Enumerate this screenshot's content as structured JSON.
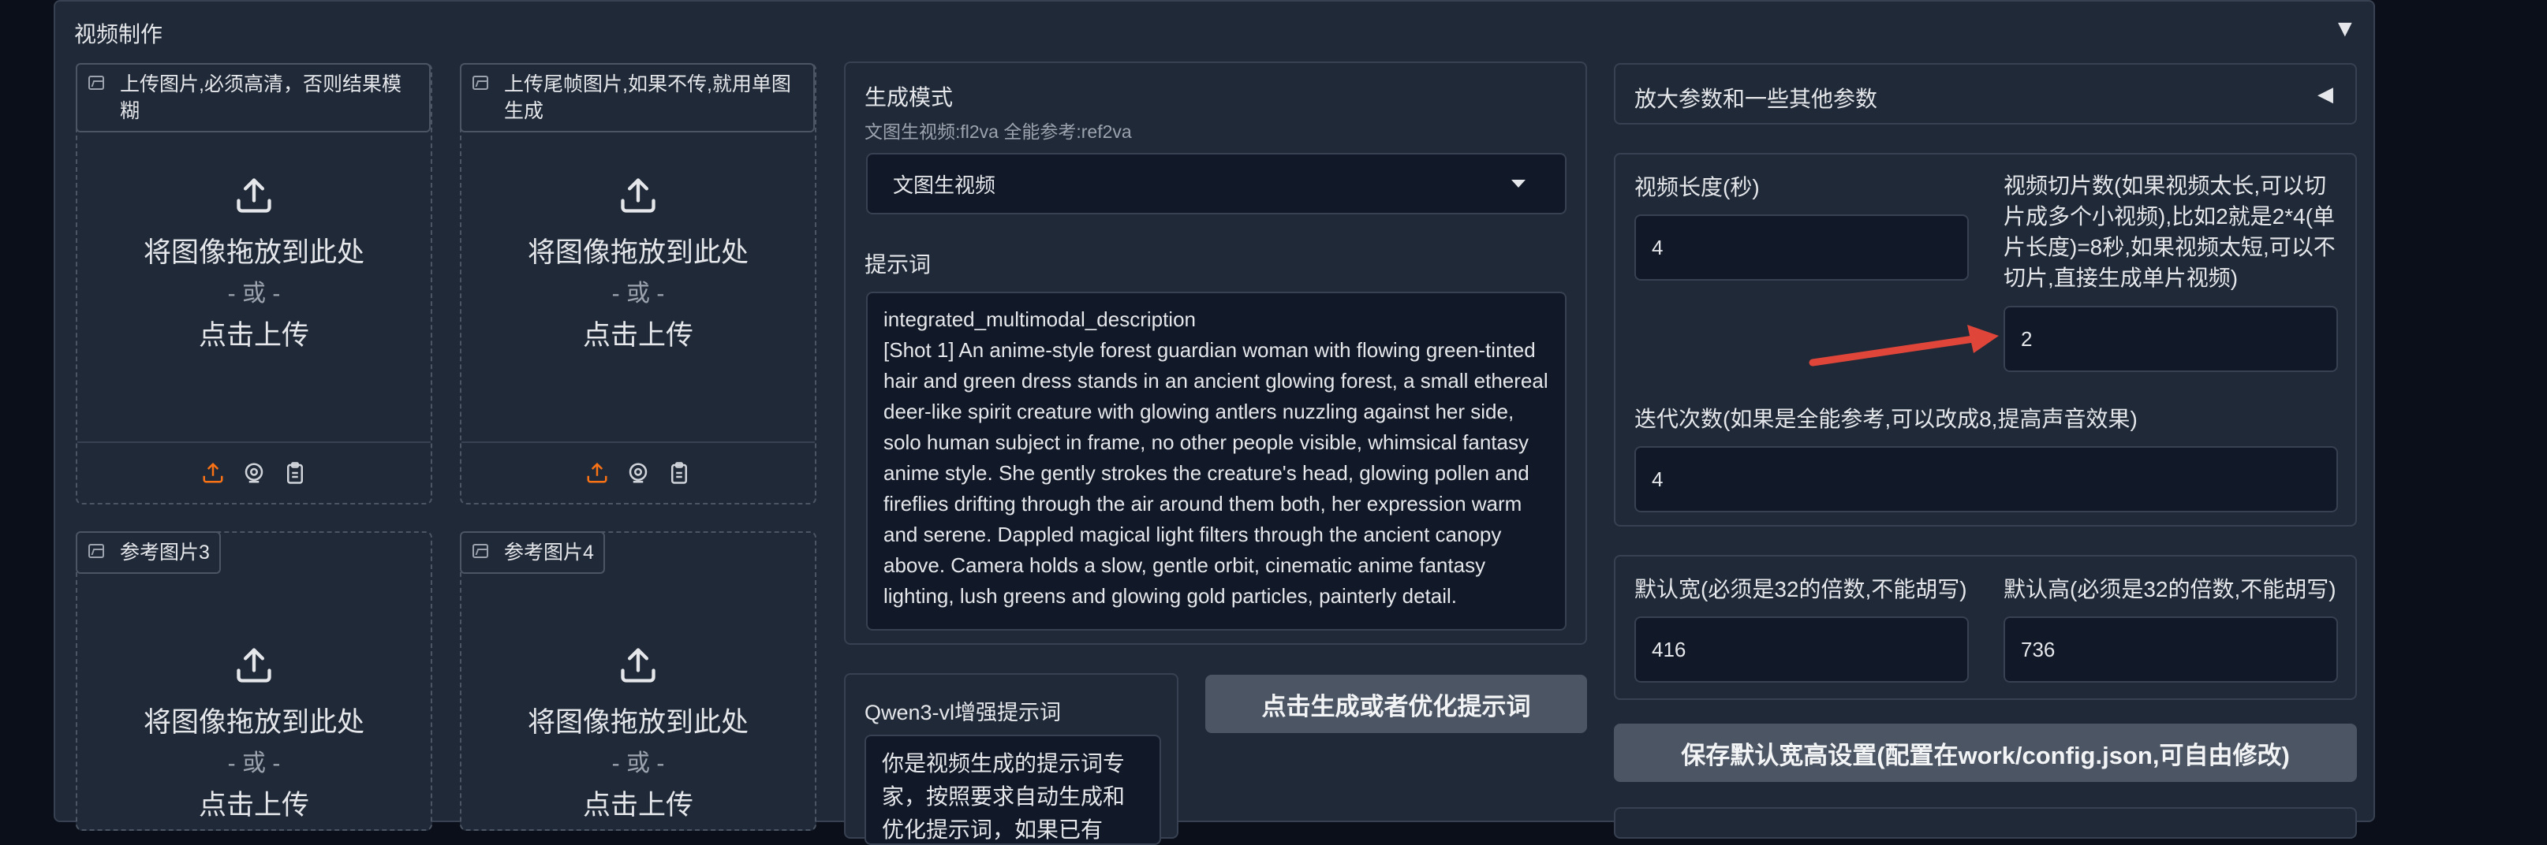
{
  "accordion": {
    "title": "视频制作",
    "arrow": "▼"
  },
  "uploads": [
    {
      "label": "上传图片,必须高清，否则结果模糊",
      "drop": "将图像拖放到此处",
      "or": "- 或 -",
      "click": "点击上传"
    },
    {
      "label": "上传尾帧图片,如果不传,就用单图生成",
      "drop": "将图像拖放到此处",
      "or": "- 或 -",
      "click": "点击上传"
    },
    {
      "label": "参考图片3",
      "drop": "将图像拖放到此处",
      "or": "- 或 -",
      "click": "点击上传"
    },
    {
      "label": "参考图片4",
      "drop": "将图像拖放到此处",
      "or": "- 或 -",
      "click": "点击上传"
    }
  ],
  "generation": {
    "mode_label": "生成模式",
    "mode_hint": "文图生视频:fl2va 全能参考:ref2va",
    "mode_value": "文图生视频",
    "prompt_label": "提示词",
    "prompt_text": "integrated_multimodal_description\n[Shot 1] An anime-style forest guardian woman with flowing green-tinted hair and green dress stands in an ancient glowing forest, a small ethereal deer-like spirit creature with glowing antlers nuzzling against her side, solo human subject in frame, no other people visible, whimsical fantasy anime style. She gently strokes the creature's head, glowing pollen and fireflies drifting through the air around them both, her expression warm and serene. Dappled magical light filters through the ancient canopy above. Camera holds a slow, gentle orbit, cinematic anime fantasy lighting, lush greens and glowing gold particles, painterly detail."
  },
  "qwen": {
    "label": "Qwen3-vl增强提示词",
    "text": "你是视频生成的提示词专家，按照要求自动生成和优化提示词，如果已有",
    "button": "点击生成或者优化提示词"
  },
  "params": {
    "accordion_title": "放大参数和一些其他参数",
    "accordion_arrow": "◀",
    "video_length_label": "视频长度(秒)",
    "video_length_value": "4",
    "slices_label": "视频切片数(如果视频太长,可以切片成多个小视频),比如2就是2*4(单片长度)=8秒,如果视频太短,可以不切片,直接生成单片视频)",
    "slices_value": "2",
    "iterations_label": "迭代次数(如果是全能参考,可以改成8,提高声音效果)",
    "iterations_value": "4",
    "width_label": "默认宽(必须是32的倍数,不能胡写)",
    "width_value": "416",
    "height_label": "默认高(必须是32的倍数,不能胡写)",
    "height_value": "736",
    "save_button": "保存默认宽高设置(配置在work/config.json,可自由修改)"
  },
  "colors": {
    "accent_arrow": "#e0453a",
    "upload_accent": "#f97316"
  }
}
